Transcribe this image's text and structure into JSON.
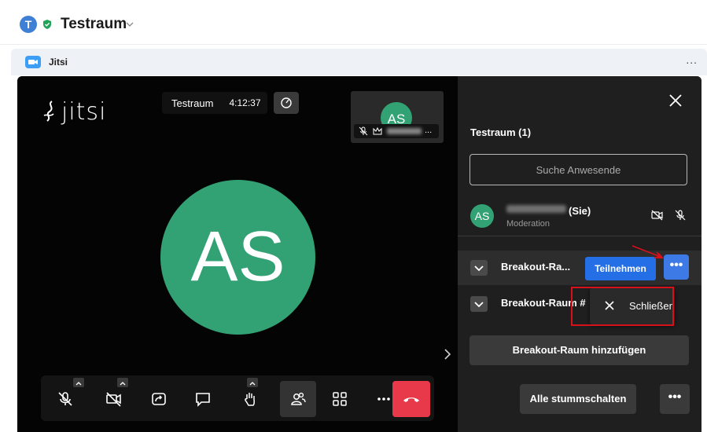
{
  "header": {
    "avatar_letter": "T",
    "title": "Testraum"
  },
  "widget": {
    "title": "Jitsi",
    "menu_label": "..."
  },
  "call": {
    "logo_text": "jitsi",
    "room_name": "Testraum",
    "timer": "4:12:37",
    "tile_initials": "AS",
    "tile_name_suffix": "...",
    "big_initials": "AS"
  },
  "panel": {
    "heading": "Testraum (1)",
    "search_placeholder": "Suche Anwesende",
    "participant": {
      "initials": "AS",
      "name_suffix": "(Sie)",
      "role": "Moderation"
    },
    "breakout_rooms": [
      {
        "name": "Breakout-Ra...",
        "join_label": "Teilnehmen",
        "more_label": "•••"
      },
      {
        "name": "Breakout-Raum #"
      }
    ],
    "dropdown_item": "Schließen",
    "add_room_label": "Breakout-Raum hinzufügen",
    "mute_all_label": "Alle stummschalten",
    "more_label": "•••"
  },
  "colors": {
    "accent_blue": "#246fe5",
    "avatar_green": "#32a275",
    "hangup_red": "#e8394a",
    "annotation_red": "#d8101c"
  }
}
